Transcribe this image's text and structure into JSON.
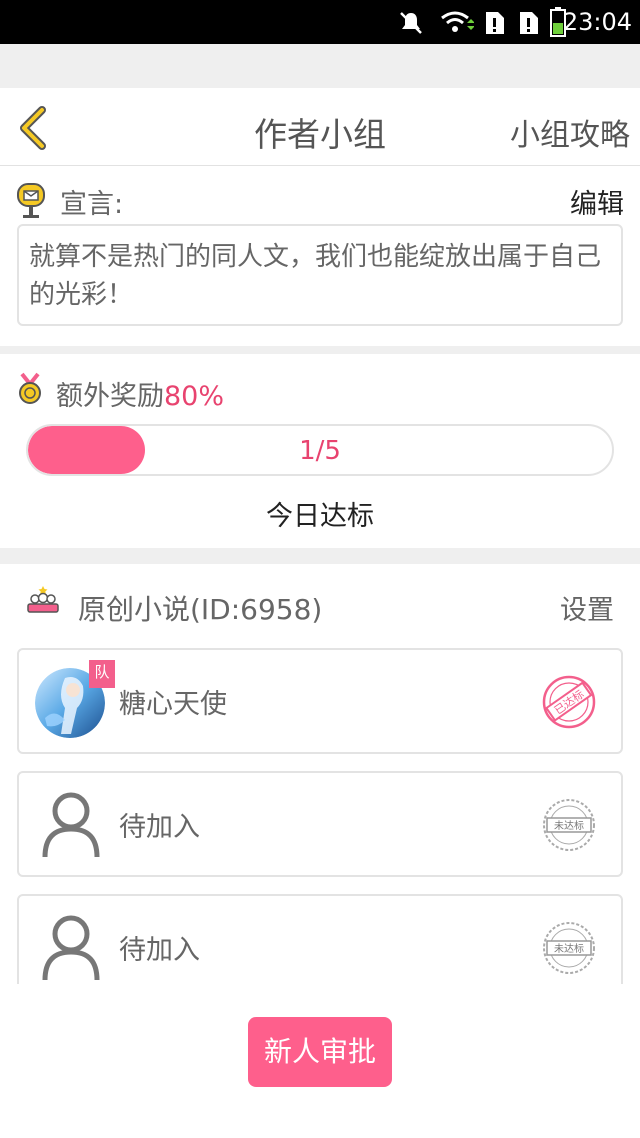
{
  "status_bar": {
    "time": "23:04",
    "icons": [
      "mute-icon",
      "wifi-icon",
      "sim1-icon",
      "sim2-icon",
      "battery-icon"
    ]
  },
  "nav": {
    "back_icon": "chevron-left-icon",
    "title": "作者小组",
    "right_link": "小组攻略"
  },
  "declaration": {
    "icon": "mailbox-icon",
    "label": "宣言:",
    "edit_label": "编辑",
    "text": "就算不是热门的同人文，我们也能绽放出属于自己的光彩！"
  },
  "reward": {
    "icon": "medal-icon",
    "label": "额外奖励",
    "percent": "80%",
    "progress_text": "1/5",
    "progress_fraction": 0.2,
    "status": "今日达标"
  },
  "group": {
    "icon": "team-icon",
    "title": "原创小说(ID:6958)",
    "settings_label": "设置"
  },
  "members": [
    {
      "name": "糖心天使",
      "badge": "队",
      "stamp": "已达标",
      "state": "achieved"
    },
    {
      "name": "待加入",
      "stamp": "未达标",
      "state": "pending"
    },
    {
      "name": "待加入",
      "stamp": "未达标",
      "state": "pending"
    }
  ],
  "footer": {
    "approve_label": "新人审批"
  },
  "colors": {
    "accent_pink": "#fe5f8c",
    "accent_red_text": "#e8436f",
    "back_arrow_yellow": "#f5c924",
    "divider_gray": "#efefef"
  }
}
